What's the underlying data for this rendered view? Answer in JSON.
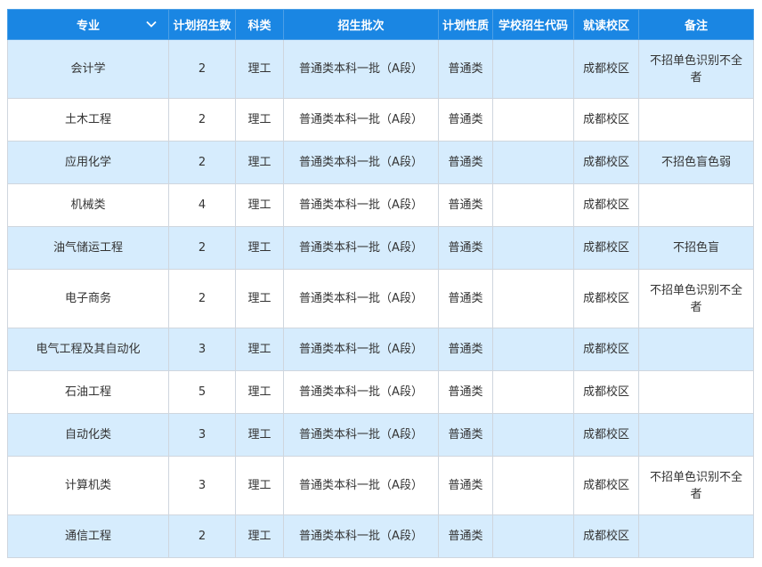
{
  "headers": {
    "major": "专业",
    "plan_count": "计划招生数",
    "subject": "科类",
    "batch": "招生批次",
    "plan_nature": "计划性质",
    "school_code": "学校招生代码",
    "campus": "就读校区",
    "remark": "备注"
  },
  "icons": {
    "sort": "chevron-down-icon"
  },
  "colors": {
    "header_bg": "#1a86e3",
    "row_alt_bg": "#d6ecfd"
  },
  "rows": [
    {
      "major": "会计学",
      "count": "2",
      "subject": "理工",
      "batch": "普通类本科一批（A段）",
      "nature": "普通类",
      "code": "",
      "campus": "成都校区",
      "remark": "不招单色识别不全者"
    },
    {
      "major": "土木工程",
      "count": "2",
      "subject": "理工",
      "batch": "普通类本科一批（A段）",
      "nature": "普通类",
      "code": "",
      "campus": "成都校区",
      "remark": ""
    },
    {
      "major": "应用化学",
      "count": "2",
      "subject": "理工",
      "batch": "普通类本科一批（A段）",
      "nature": "普通类",
      "code": "",
      "campus": "成都校区",
      "remark": "不招色盲色弱"
    },
    {
      "major": "机械类",
      "count": "4",
      "subject": "理工",
      "batch": "普通类本科一批（A段）",
      "nature": "普通类",
      "code": "",
      "campus": "成都校区",
      "remark": ""
    },
    {
      "major": "油气储运工程",
      "count": "2",
      "subject": "理工",
      "batch": "普通类本科一批（A段）",
      "nature": "普通类",
      "code": "",
      "campus": "成都校区",
      "remark": "不招色盲"
    },
    {
      "major": "电子商务",
      "count": "2",
      "subject": "理工",
      "batch": "普通类本科一批（A段）",
      "nature": "普通类",
      "code": "",
      "campus": "成都校区",
      "remark": "不招单色识别不全者"
    },
    {
      "major": "电气工程及其自动化",
      "count": "3",
      "subject": "理工",
      "batch": "普通类本科一批（A段）",
      "nature": "普通类",
      "code": "",
      "campus": "成都校区",
      "remark": ""
    },
    {
      "major": "石油工程",
      "count": "5",
      "subject": "理工",
      "batch": "普通类本科一批（A段）",
      "nature": "普通类",
      "code": "",
      "campus": "成都校区",
      "remark": ""
    },
    {
      "major": "自动化类",
      "count": "3",
      "subject": "理工",
      "batch": "普通类本科一批（A段）",
      "nature": "普通类",
      "code": "",
      "campus": "成都校区",
      "remark": ""
    },
    {
      "major": "计算机类",
      "count": "3",
      "subject": "理工",
      "batch": "普通类本科一批（A段）",
      "nature": "普通类",
      "code": "",
      "campus": "成都校区",
      "remark": "不招单色识别不全者"
    },
    {
      "major": "通信工程",
      "count": "2",
      "subject": "理工",
      "batch": "普通类本科一批（A段）",
      "nature": "普通类",
      "code": "",
      "campus": "成都校区",
      "remark": ""
    }
  ]
}
